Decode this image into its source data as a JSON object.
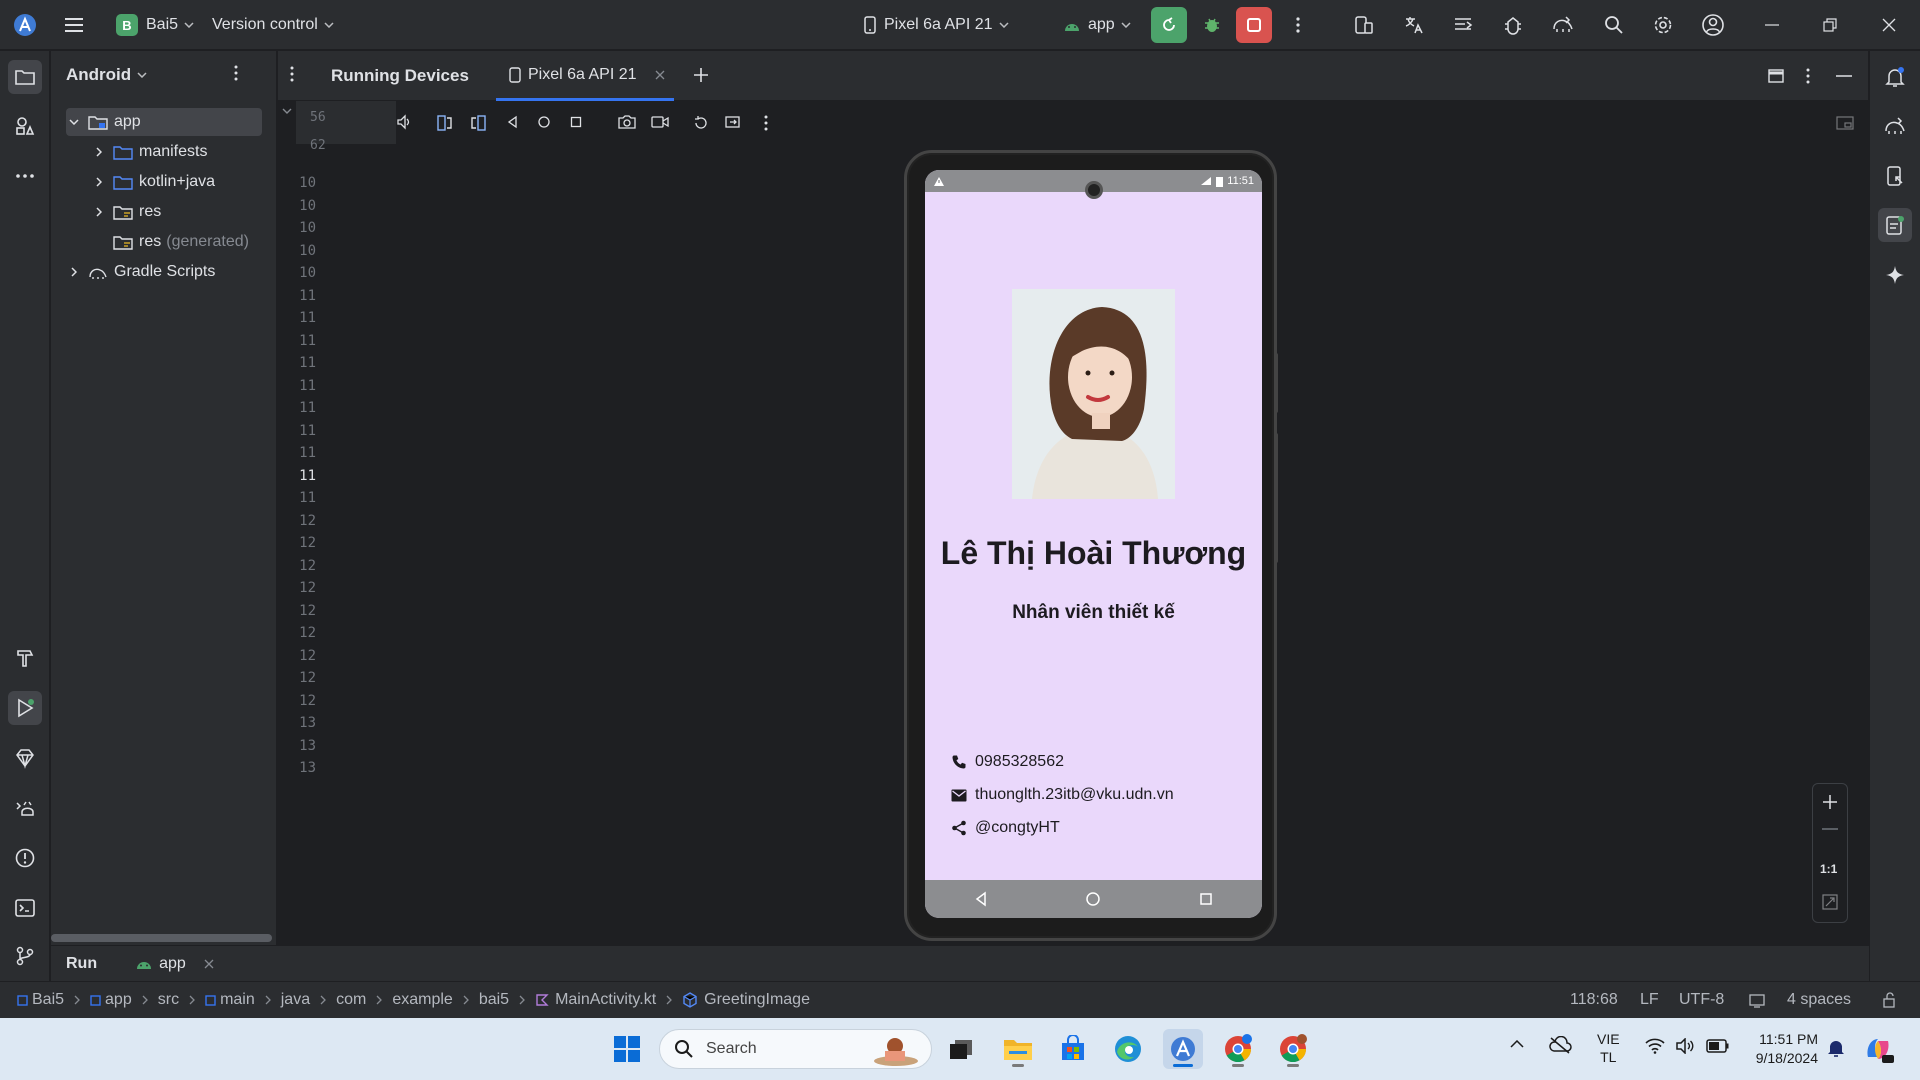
{
  "titlebar": {
    "project_letter": "B",
    "project_name": "Bai5",
    "version_control": "Version control",
    "device": "Pixel 6a API 21",
    "run_config": "app"
  },
  "project_panel": {
    "view": "Android",
    "tree": [
      {
        "label": "app",
        "level": 0,
        "expanded": true,
        "selected": true
      },
      {
        "label": "manifests",
        "level": 1
      },
      {
        "label": "kotlin+java",
        "level": 1
      },
      {
        "label": "res",
        "level": 1
      },
      {
        "label": "res",
        "suffix": "(generated)",
        "level": 1
      },
      {
        "label": "Gradle Scripts",
        "level": 0
      }
    ]
  },
  "gutter": {
    "partial_top": [
      "56",
      "62"
    ],
    "lines": [
      "10",
      "10",
      "10",
      "10",
      "10",
      "11",
      "11",
      "11",
      "11",
      "11",
      "11",
      "11",
      "11",
      "11",
      "11",
      "12",
      "12",
      "12",
      "12",
      "12",
      "12",
      "12",
      "12",
      "12",
      "13",
      "13",
      "13"
    ],
    "current_index": 13
  },
  "running_devices": {
    "title": "Running Devices",
    "tab": "Pixel 6a API 21"
  },
  "phone": {
    "status_time": "11:51",
    "name": "Lê Thị Hoài Thương",
    "role": "Nhân viên thiết kế",
    "phone_number": "0985328562",
    "email": "thuonglth.23itb@vku.udn.vn",
    "social": "@congtyHT",
    "background_color": "#ead8fb"
  },
  "zoom": {
    "reset_label": "1:1"
  },
  "runbar": {
    "run_label": "Run",
    "tab": "app"
  },
  "statusbar": {
    "breadcrumbs": [
      "Bai5",
      "app",
      "src",
      "main",
      "java",
      "com",
      "example",
      "bai5",
      "MainActivity.kt",
      "GreetingImage"
    ],
    "position": "118:68",
    "line_sep": "LF",
    "encoding": "UTF-8",
    "indent": "4 spaces"
  },
  "taskbar": {
    "search_placeholder": "Search",
    "lang_top": "VIE",
    "lang_bottom": "TL",
    "time": "11:51 PM",
    "date": "9/18/2024"
  }
}
